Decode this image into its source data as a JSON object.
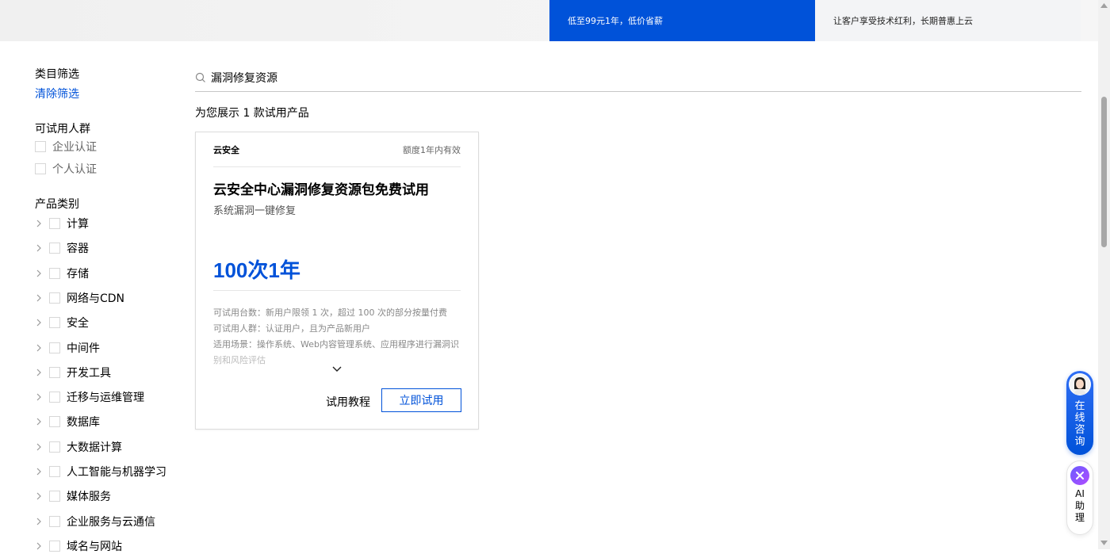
{
  "banner": {
    "tab_promo": "低至99元1年，低价省薪",
    "tab_benefit": "让客户享受技术红利，长期普惠上云"
  },
  "sidebar": {
    "filter_title": "类目筛选",
    "clear_filter": "清除筛选",
    "audience": {
      "title": "可试用人群",
      "options": [
        "企业认证",
        "个人认证"
      ]
    },
    "category": {
      "title": "产品类别",
      "items": [
        "计算",
        "容器",
        "存储",
        "网络与CDN",
        "安全",
        "中间件",
        "开发工具",
        "迁移与运维管理",
        "数据库",
        "大数据计算",
        "人工智能与机器学习",
        "媒体服务",
        "企业服务与云通信",
        "域名与网站"
      ]
    }
  },
  "search": {
    "value": "漏洞修复资源"
  },
  "results": {
    "count_text": "为您展示 1 款试用产品"
  },
  "card": {
    "brand": "云安全",
    "validity": "额度1年内有效",
    "title": "云安全中心漏洞修复资源包免费试用",
    "subtitle": "系统漏洞一键修复",
    "quota": "100次1年",
    "detail_1": "可试用台数：新用户限领 1 次，超过 100 次的部分按量付费",
    "detail_2": "可试用人群：认证用户，且为产品新用户",
    "detail_3": "适用场景：操作系统、Web内容管理系统、应用程序进行漏洞识",
    "detail_4": "别和风险评估",
    "tutorial_label": "试用教程",
    "try_label": "立即试用"
  },
  "floating": {
    "consult_label": "在线咨询",
    "ai_label": "AI助理"
  },
  "colors": {
    "accent": "#0052d9"
  }
}
